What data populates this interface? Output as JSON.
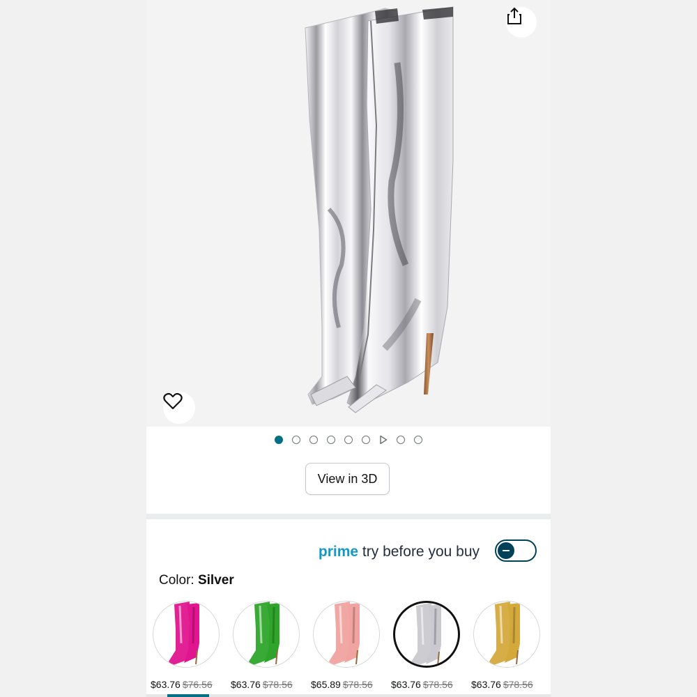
{
  "gallery": {
    "image_count": 9,
    "active_index": 0,
    "video_index": 6,
    "image_alt": "Silver metallic knee-high pointed toe stiletto boots"
  },
  "buttons": {
    "view_3d": "View in 3D"
  },
  "prime": {
    "brand": "prime",
    "text": "try before you buy",
    "toggle_on": false,
    "brand_color": "#1399c6"
  },
  "color": {
    "label": "Color:",
    "selected": "Silver"
  },
  "swatches": [
    {
      "name": "Pink",
      "color": "#e0158f",
      "price": "$63.76",
      "old_price": "$76.56"
    },
    {
      "name": "Green",
      "color": "#2ea52a",
      "price": "$63.76",
      "old_price": "$78.56"
    },
    {
      "name": "Rose",
      "color": "#f0a3a0",
      "price": "$65.89",
      "old_price": "$78.56"
    },
    {
      "name": "Silver",
      "color": "#c9c9cf",
      "price": "$63.76",
      "old_price": "$78.56",
      "selected": true
    },
    {
      "name": "Gold",
      "color": "#d4a93c",
      "price": "$63.76",
      "old_price": "$78.56"
    }
  ],
  "icons": {
    "share": "share-icon",
    "favorite": "heart-icon",
    "play": "play-icon"
  }
}
